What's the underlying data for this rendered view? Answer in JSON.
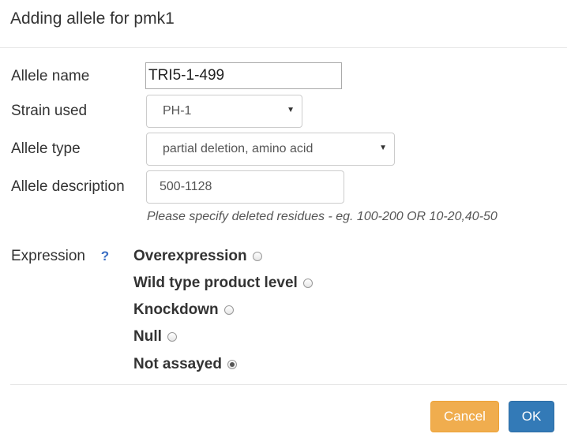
{
  "dialog": {
    "title": "Adding allele for pmk1"
  },
  "form": {
    "allele_name": {
      "label": "Allele name",
      "value": "TRI5-1-499"
    },
    "strain": {
      "label": "Strain used",
      "value": "PH-1"
    },
    "allele_type": {
      "label": "Allele type",
      "value": "partial deletion, amino acid"
    },
    "allele_description": {
      "label": "Allele description",
      "value": "500-1128",
      "help": "Please specify deleted residues - eg. 100-200 OR 10-20,40-50"
    },
    "expression": {
      "label": "Expression",
      "help_icon": "?",
      "options": [
        {
          "label": "Overexpression",
          "checked": false
        },
        {
          "label": "Wild type product level",
          "checked": false
        },
        {
          "label": "Knockdown",
          "checked": false
        },
        {
          "label": "Null",
          "checked": false
        },
        {
          "label": "Not assayed",
          "checked": true
        }
      ]
    }
  },
  "footer": {
    "cancel_label": "Cancel",
    "ok_label": "OK"
  },
  "colors": {
    "cancel": "#f0ad4e",
    "ok": "#337ab7",
    "help_icon": "#3b6fc4"
  }
}
